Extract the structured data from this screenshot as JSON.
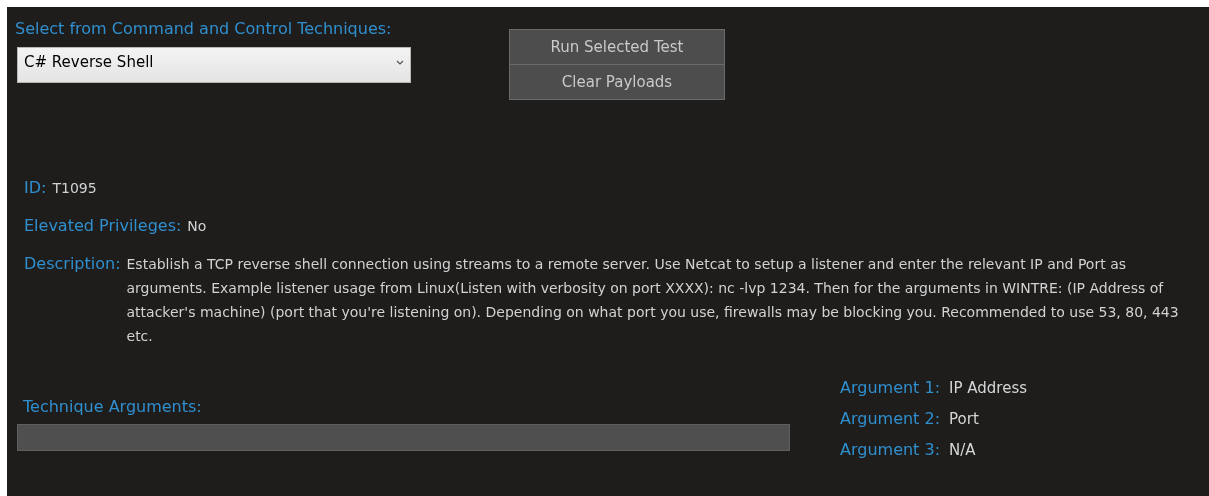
{
  "technique_select": {
    "label": "Select from Command and Control Techniques:",
    "value": "C# Reverse Shell"
  },
  "buttons": [
    "Run Selected Test",
    "Clear Payloads"
  ],
  "details": [
    {
      "label": "ID:",
      "value": "T1095"
    },
    {
      "label": "Elevated Privileges:",
      "value": "No"
    },
    {
      "label": "Description:",
      "value": "Establish a TCP reverse shell connection using streams to a remote server. Use Netcat to setup a listener and enter the relevant IP and Port as arguments. Example listener usage from Linux(Listen with verbosity on port XXXX): nc -lvp 1234. Then for the arguments in WINTRE: (IP Address of attacker's machine) (port that you're listening on). Depending on what port you use, firewalls may be blocking you. Recommended to use 53, 80, 443 etc."
    }
  ],
  "technique_arguments": {
    "label": "Technique Arguments:"
  },
  "arguments": [
    {
      "label": "Argument 1:",
      "value": "IP Address"
    },
    {
      "label": "Argument 2:",
      "value": "Port"
    },
    {
      "label": "Argument 3:",
      "value": "N/A"
    }
  ]
}
